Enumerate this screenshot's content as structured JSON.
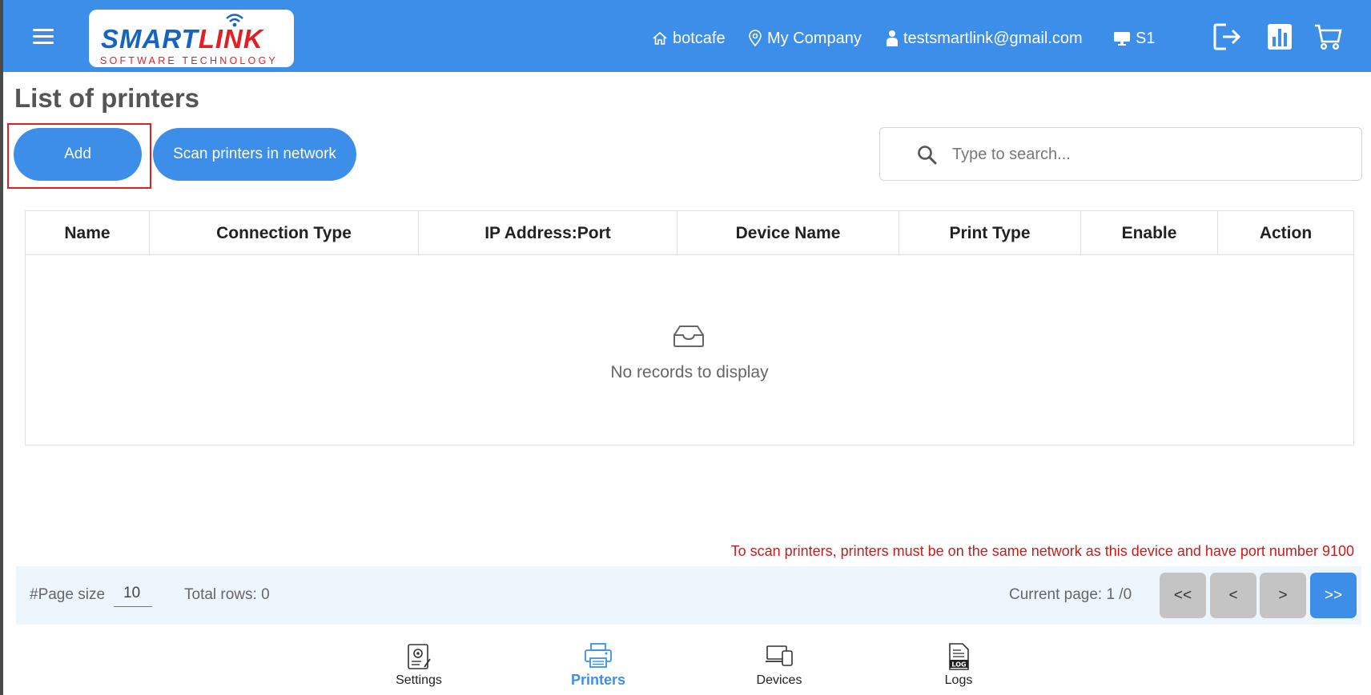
{
  "header": {
    "logo_main_a": "SMART",
    "logo_main_b": "LINK",
    "logo_sub": "SOFTWARE TECHNOLOGY",
    "store": "botcafe",
    "company": "My Company",
    "email": "testsmartlink@gmail.com",
    "station": "S1",
    "icons": [
      "menu-icon",
      "home-icon",
      "location-pin-icon",
      "user-icon",
      "monitor-icon",
      "logout-icon",
      "bar-chart-icon",
      "cart-icon"
    ]
  },
  "page": {
    "title": "List of printers",
    "add_label": "Add",
    "scan_label": "Scan printers in network",
    "search_placeholder": "Type to search..."
  },
  "table": {
    "columns": [
      "Name",
      "Connection Type",
      "IP Address:Port",
      "Device Name",
      "Print Type",
      "Enable",
      "Action"
    ],
    "rows": [],
    "empty_text": "No records to display"
  },
  "note": "To scan printers, printers must be on the same network as this device and have port number 9100",
  "pager": {
    "page_size_label": "#Page size",
    "page_size_value": "10",
    "total_rows": "Total rows: 0",
    "current_page": "Current page: 1 /0",
    "first": "<<",
    "prev": "<",
    "next": ">",
    "last": ">>"
  },
  "bottom_nav": {
    "settings": "Settings",
    "printers": "Printers",
    "devices": "Devices",
    "logs": "Logs",
    "active": "Printers"
  },
  "colors": {
    "primary": "#3d8ee9",
    "warning_text": "#cc1a1a",
    "pager_bg": "#edf5fd",
    "pager_btn_grey": "#c4c4c4",
    "highlight_border": "#e02020"
  }
}
